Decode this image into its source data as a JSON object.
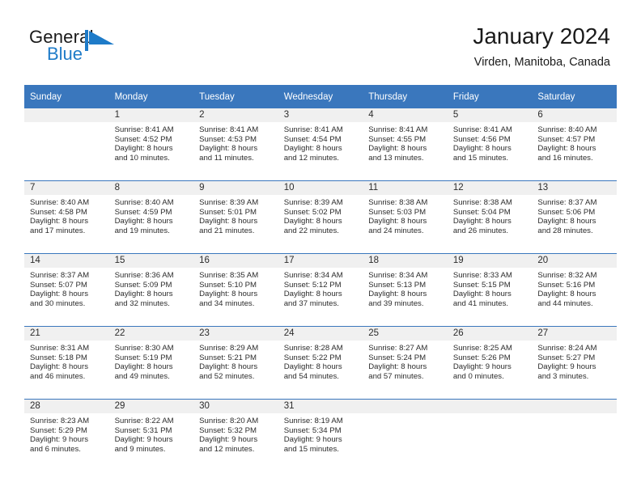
{
  "brand": {
    "name_part1": "General",
    "name_part2": "Blue",
    "flag_color": "#1e7bc8"
  },
  "header": {
    "title": "January 2024",
    "subtitle": "Virden, Manitoba, Canada"
  },
  "theme": {
    "header_blue": "#3a77bd",
    "band_gray": "#f0f0f0",
    "text": "#2c2c2c"
  },
  "weekday_headers": [
    "Sunday",
    "Monday",
    "Tuesday",
    "Wednesday",
    "Thursday",
    "Friday",
    "Saturday"
  ],
  "weeks": [
    [
      {
        "day": "",
        "lines": []
      },
      {
        "day": "1",
        "lines": [
          "Sunrise: 8:41 AM",
          "Sunset: 4:52 PM",
          "Daylight: 8 hours",
          "and 10 minutes."
        ]
      },
      {
        "day": "2",
        "lines": [
          "Sunrise: 8:41 AM",
          "Sunset: 4:53 PM",
          "Daylight: 8 hours",
          "and 11 minutes."
        ]
      },
      {
        "day": "3",
        "lines": [
          "Sunrise: 8:41 AM",
          "Sunset: 4:54 PM",
          "Daylight: 8 hours",
          "and 12 minutes."
        ]
      },
      {
        "day": "4",
        "lines": [
          "Sunrise: 8:41 AM",
          "Sunset: 4:55 PM",
          "Daylight: 8 hours",
          "and 13 minutes."
        ]
      },
      {
        "day": "5",
        "lines": [
          "Sunrise: 8:41 AM",
          "Sunset: 4:56 PM",
          "Daylight: 8 hours",
          "and 15 minutes."
        ]
      },
      {
        "day": "6",
        "lines": [
          "Sunrise: 8:40 AM",
          "Sunset: 4:57 PM",
          "Daylight: 8 hours",
          "and 16 minutes."
        ]
      }
    ],
    [
      {
        "day": "7",
        "lines": [
          "Sunrise: 8:40 AM",
          "Sunset: 4:58 PM",
          "Daylight: 8 hours",
          "and 17 minutes."
        ]
      },
      {
        "day": "8",
        "lines": [
          "Sunrise: 8:40 AM",
          "Sunset: 4:59 PM",
          "Daylight: 8 hours",
          "and 19 minutes."
        ]
      },
      {
        "day": "9",
        "lines": [
          "Sunrise: 8:39 AM",
          "Sunset: 5:01 PM",
          "Daylight: 8 hours",
          "and 21 minutes."
        ]
      },
      {
        "day": "10",
        "lines": [
          "Sunrise: 8:39 AM",
          "Sunset: 5:02 PM",
          "Daylight: 8 hours",
          "and 22 minutes."
        ]
      },
      {
        "day": "11",
        "lines": [
          "Sunrise: 8:38 AM",
          "Sunset: 5:03 PM",
          "Daylight: 8 hours",
          "and 24 minutes."
        ]
      },
      {
        "day": "12",
        "lines": [
          "Sunrise: 8:38 AM",
          "Sunset: 5:04 PM",
          "Daylight: 8 hours",
          "and 26 minutes."
        ]
      },
      {
        "day": "13",
        "lines": [
          "Sunrise: 8:37 AM",
          "Sunset: 5:06 PM",
          "Daylight: 8 hours",
          "and 28 minutes."
        ]
      }
    ],
    [
      {
        "day": "14",
        "lines": [
          "Sunrise: 8:37 AM",
          "Sunset: 5:07 PM",
          "Daylight: 8 hours",
          "and 30 minutes."
        ]
      },
      {
        "day": "15",
        "lines": [
          "Sunrise: 8:36 AM",
          "Sunset: 5:09 PM",
          "Daylight: 8 hours",
          "and 32 minutes."
        ]
      },
      {
        "day": "16",
        "lines": [
          "Sunrise: 8:35 AM",
          "Sunset: 5:10 PM",
          "Daylight: 8 hours",
          "and 34 minutes."
        ]
      },
      {
        "day": "17",
        "lines": [
          "Sunrise: 8:34 AM",
          "Sunset: 5:12 PM",
          "Daylight: 8 hours",
          "and 37 minutes."
        ]
      },
      {
        "day": "18",
        "lines": [
          "Sunrise: 8:34 AM",
          "Sunset: 5:13 PM",
          "Daylight: 8 hours",
          "and 39 minutes."
        ]
      },
      {
        "day": "19",
        "lines": [
          "Sunrise: 8:33 AM",
          "Sunset: 5:15 PM",
          "Daylight: 8 hours",
          "and 41 minutes."
        ]
      },
      {
        "day": "20",
        "lines": [
          "Sunrise: 8:32 AM",
          "Sunset: 5:16 PM",
          "Daylight: 8 hours",
          "and 44 minutes."
        ]
      }
    ],
    [
      {
        "day": "21",
        "lines": [
          "Sunrise: 8:31 AM",
          "Sunset: 5:18 PM",
          "Daylight: 8 hours",
          "and 46 minutes."
        ]
      },
      {
        "day": "22",
        "lines": [
          "Sunrise: 8:30 AM",
          "Sunset: 5:19 PM",
          "Daylight: 8 hours",
          "and 49 minutes."
        ]
      },
      {
        "day": "23",
        "lines": [
          "Sunrise: 8:29 AM",
          "Sunset: 5:21 PM",
          "Daylight: 8 hours",
          "and 52 minutes."
        ]
      },
      {
        "day": "24",
        "lines": [
          "Sunrise: 8:28 AM",
          "Sunset: 5:22 PM",
          "Daylight: 8 hours",
          "and 54 minutes."
        ]
      },
      {
        "day": "25",
        "lines": [
          "Sunrise: 8:27 AM",
          "Sunset: 5:24 PM",
          "Daylight: 8 hours",
          "and 57 minutes."
        ]
      },
      {
        "day": "26",
        "lines": [
          "Sunrise: 8:25 AM",
          "Sunset: 5:26 PM",
          "Daylight: 9 hours",
          "and 0 minutes."
        ]
      },
      {
        "day": "27",
        "lines": [
          "Sunrise: 8:24 AM",
          "Sunset: 5:27 PM",
          "Daylight: 9 hours",
          "and 3 minutes."
        ]
      }
    ],
    [
      {
        "day": "28",
        "lines": [
          "Sunrise: 8:23 AM",
          "Sunset: 5:29 PM",
          "Daylight: 9 hours",
          "and 6 minutes."
        ]
      },
      {
        "day": "29",
        "lines": [
          "Sunrise: 8:22 AM",
          "Sunset: 5:31 PM",
          "Daylight: 9 hours",
          "and 9 minutes."
        ]
      },
      {
        "day": "30",
        "lines": [
          "Sunrise: 8:20 AM",
          "Sunset: 5:32 PM",
          "Daylight: 9 hours",
          "and 12 minutes."
        ]
      },
      {
        "day": "31",
        "lines": [
          "Sunrise: 8:19 AM",
          "Sunset: 5:34 PM",
          "Daylight: 9 hours",
          "and 15 minutes."
        ]
      },
      {
        "day": "",
        "lines": []
      },
      {
        "day": "",
        "lines": []
      },
      {
        "day": "",
        "lines": []
      }
    ]
  ]
}
